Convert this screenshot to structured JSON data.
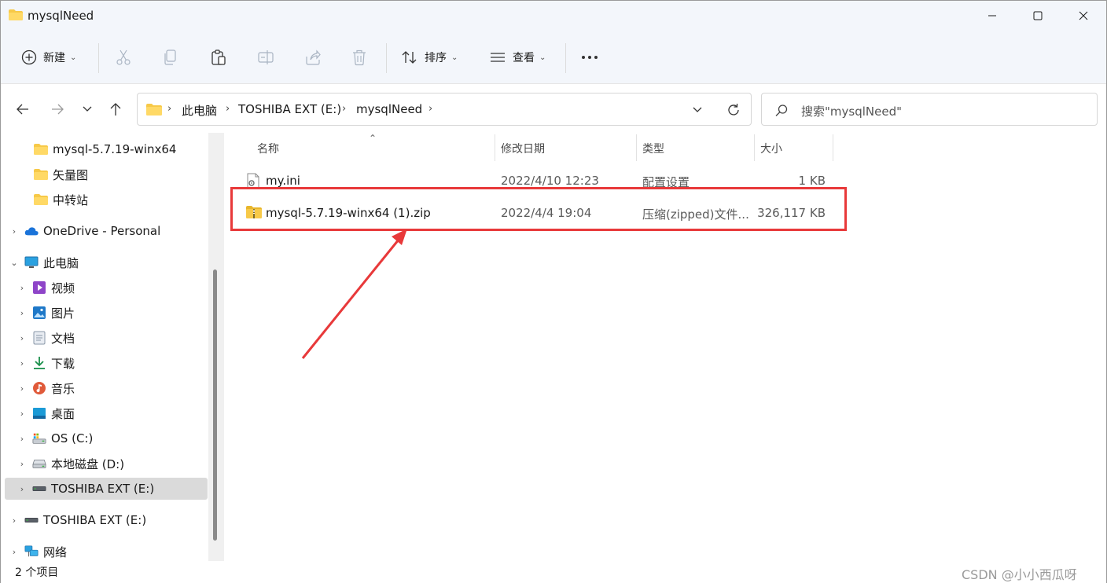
{
  "window": {
    "title": "mysqlNeed",
    "controls": [
      "minimize-icon",
      "maximize-icon",
      "close-icon"
    ]
  },
  "toolbar": {
    "new_label": "新建",
    "sort_label": "排序",
    "view_label": "查看",
    "more_label": "..."
  },
  "address": {
    "crumbs": [
      "此电脑",
      "TOSHIBA EXT (E:)",
      "mysqlNeed"
    ],
    "search_placeholder": "搜索\"mysqlNeed\""
  },
  "nav": {
    "items": [
      {
        "label": "mysql-5.7.19-winx64",
        "icon": "folder-icon"
      },
      {
        "label": "矢量图",
        "icon": "folder-icon"
      },
      {
        "label": "中转站",
        "icon": "folder-icon"
      },
      {
        "label": "OneDrive - Personal",
        "icon": "cloud-icon"
      },
      {
        "label": "此电脑",
        "icon": "computer-icon"
      },
      {
        "label": "视频",
        "icon": "video-icon"
      },
      {
        "label": "图片",
        "icon": "pictures-icon"
      },
      {
        "label": "文档",
        "icon": "documents-icon"
      },
      {
        "label": "下载",
        "icon": "download-icon"
      },
      {
        "label": "音乐",
        "icon": "music-icon"
      },
      {
        "label": "桌面",
        "icon": "desktop-icon"
      },
      {
        "label": "OS (C:)",
        "icon": "os-drive-icon"
      },
      {
        "label": "本地磁盘 (D:)",
        "icon": "drive-icon"
      },
      {
        "label": "TOSHIBA EXT (E:)",
        "icon": "usb-drive-icon"
      },
      {
        "label": "TOSHIBA EXT (E:)",
        "icon": "usb-drive-icon"
      },
      {
        "label": "网络",
        "icon": "network-icon"
      }
    ]
  },
  "columns": {
    "name": "名称",
    "modified": "修改日期",
    "type": "类型",
    "size": "大小"
  },
  "files": [
    {
      "name": "my.ini",
      "modified": "2022/4/10 12:23",
      "type": "配置设置",
      "size": "1 KB",
      "icon": "config-file-icon"
    },
    {
      "name": "mysql-5.7.19-winx64 (1).zip",
      "modified": "2022/4/4 19:04",
      "type": "压缩(zipped)文件...",
      "size": "326,117 KB",
      "icon": "zip-folder-icon"
    }
  ],
  "status": {
    "item_count": "2 个项目",
    "watermark": "CSDN @小小西瓜呀"
  },
  "colors": {
    "accent_highlight": "#e8393a",
    "titlebar_bg": "#f3f6fb",
    "folder_yellow": "#f7c948",
    "selected_bg": "#dadada"
  }
}
